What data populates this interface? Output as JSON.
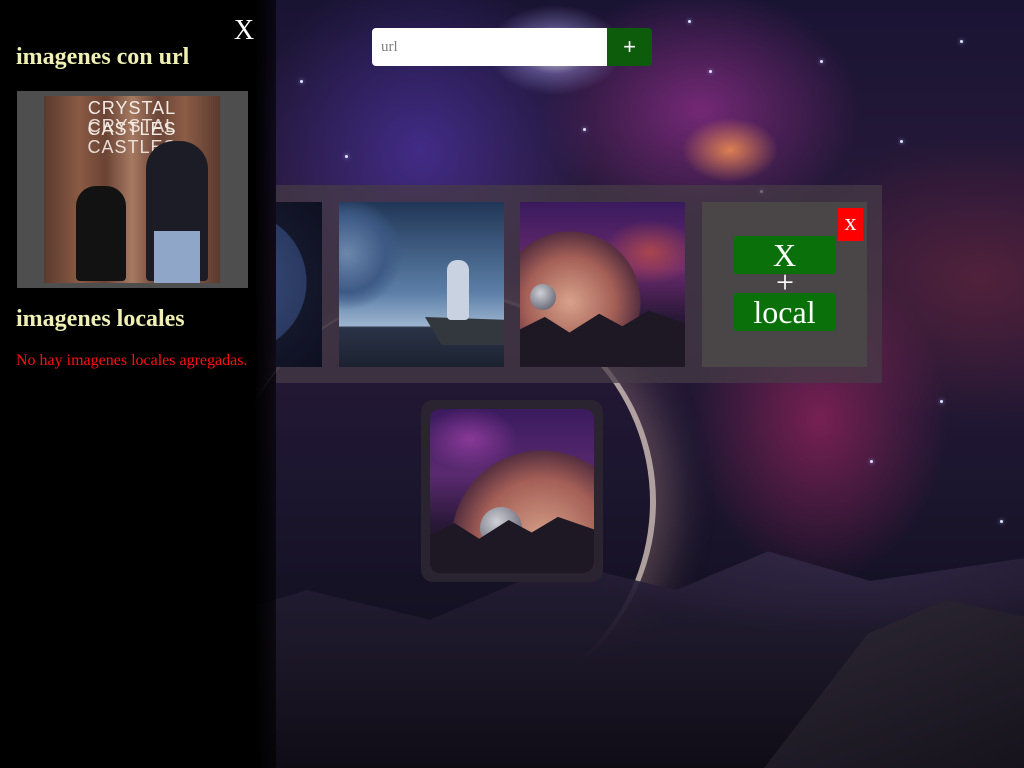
{
  "sidebar": {
    "close_label": "X",
    "url_section_title": "imagenes con url",
    "url_images": [
      {
        "album_text_line1": "CRYSTAL CASTLES",
        "album_text_line2": "CRYSTAL CASTLES"
      }
    ],
    "local_section_title": "imagenes locales",
    "no_local_message": "No hay imagenes locales agregadas."
  },
  "url_form": {
    "placeholder": "url",
    "value": "",
    "add_label": "+"
  },
  "carousel": {
    "local_card": {
      "delete_label": "x",
      "x_label": "X",
      "plus_label": "+",
      "local_label": "local"
    }
  },
  "colors": {
    "sidebar_bg": "#000000",
    "title_color": "#f0f0b4",
    "error_text": "#ff1010",
    "add_button": "#0c5c0c",
    "green_button": "#0a700a",
    "delete_button": "#ff0000"
  }
}
